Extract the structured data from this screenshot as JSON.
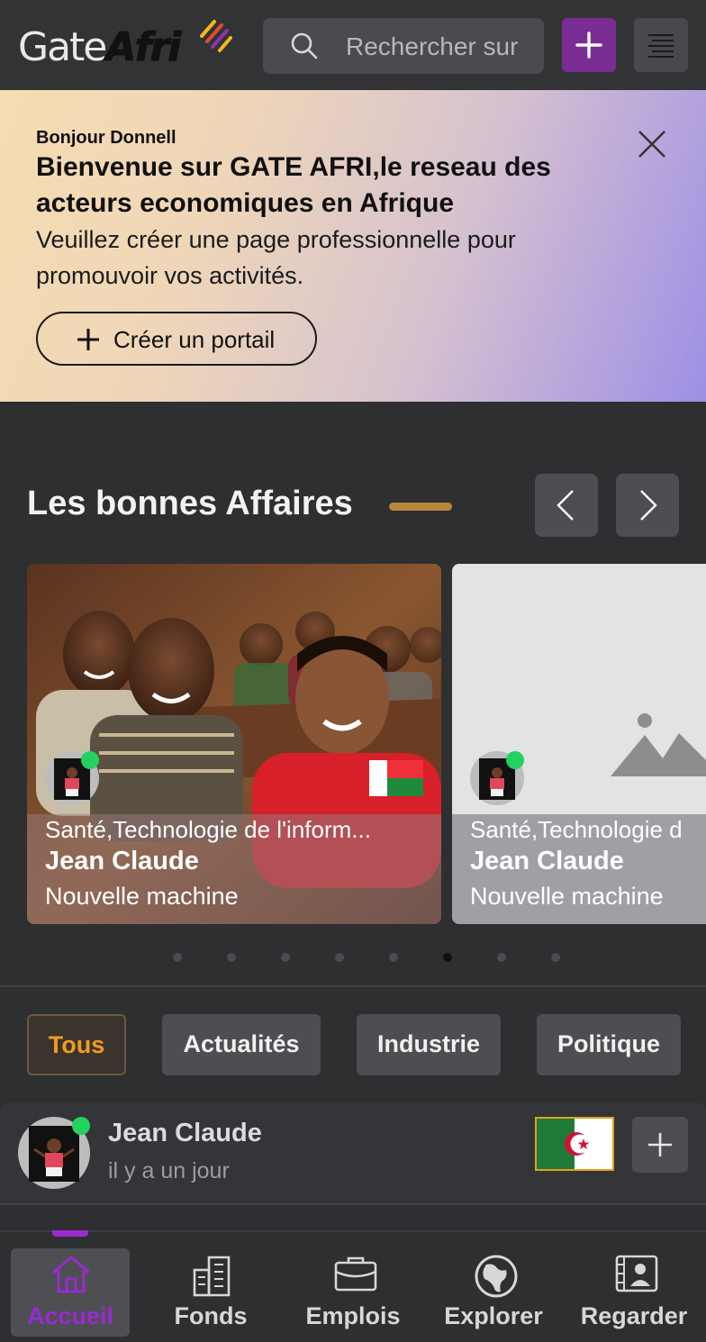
{
  "header": {
    "logo_gate": "Gate",
    "logo_afri": "Afri",
    "search_placeholder": "Rechercher sur"
  },
  "banner": {
    "greeting": "Bonjour Donnell",
    "title": "Bienvenue sur GATE AFRI,le reseau des acteurs economiques en Afrique",
    "description": "Veuillez créer une page professionnelle pour promouvoir vos activités.",
    "cta_label": "Créer un portail",
    "gradient_colors": [
      "#f6dcb1",
      "#d6c2cf",
      "#9e8fe6"
    ]
  },
  "deals": {
    "title": "Les bonnes Affaires",
    "accent_color": "#b8883a",
    "cards": [
      {
        "sector": "Santé,Technologie de l'inform...",
        "author": "Jean Claude",
        "subtitle": "Nouvelle machine",
        "flag": "madagascar-flag",
        "online": true
      },
      {
        "sector": "Santé,Technologie d",
        "author": "Jean Claude",
        "subtitle": "Nouvelle machine",
        "image": "image-placeholder-icon",
        "online": true
      }
    ],
    "carousel": {
      "total_dots": 8,
      "active_dot": 6
    }
  },
  "filters": [
    {
      "label": "Tous",
      "active": true
    },
    {
      "label": "Actualités",
      "active": false
    },
    {
      "label": "Industrie",
      "active": false
    },
    {
      "label": "Politique",
      "active": false
    }
  ],
  "post": {
    "author": "Jean Claude",
    "time": "il y a un jour",
    "flag": "algeria-flag",
    "online": true
  },
  "bottom_nav": [
    {
      "label": "Accueil",
      "icon": "home-icon",
      "active": true
    },
    {
      "label": "Fonds",
      "icon": "building-icon",
      "active": false
    },
    {
      "label": "Emplois",
      "icon": "briefcase-icon",
      "active": false
    },
    {
      "label": "Explorer",
      "icon": "globe-icon",
      "active": false
    },
    {
      "label": "Regarder",
      "icon": "video-profile-icon",
      "active": false
    }
  ],
  "colors": {
    "brand_purple": "#7a2c95",
    "active_nav": "#9b2ad1",
    "active_chip_text": "#f29b1e",
    "online": "#22d160"
  }
}
